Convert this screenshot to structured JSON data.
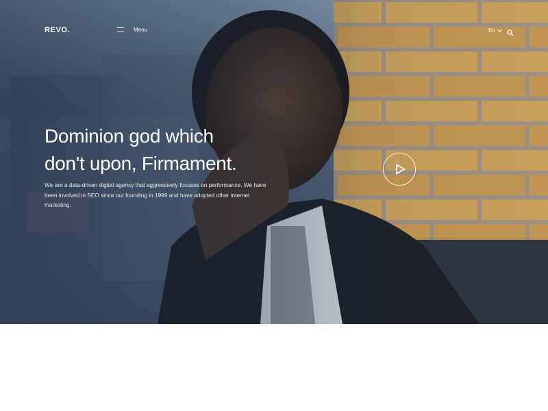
{
  "header": {
    "logo": "REVO.",
    "menu_label": "Menu",
    "language": "En"
  },
  "hero": {
    "headline_line1": "Dominion god which",
    "headline_line2": "don't upon, Firmament.",
    "description": "We are a data-driven digital agency that aggressively focuses on performance. We have been involved in SEO since our founding in 1999 and have adopted other internet marketing."
  },
  "icons": {
    "menu": "hamburger-icon",
    "language_dropdown": "chevron-down-icon",
    "search": "search-icon",
    "play": "play-icon"
  },
  "colors": {
    "overlay": "#162238",
    "text": "#ffffff",
    "brick": "#c99b4a",
    "page_background": "#ffffff"
  }
}
